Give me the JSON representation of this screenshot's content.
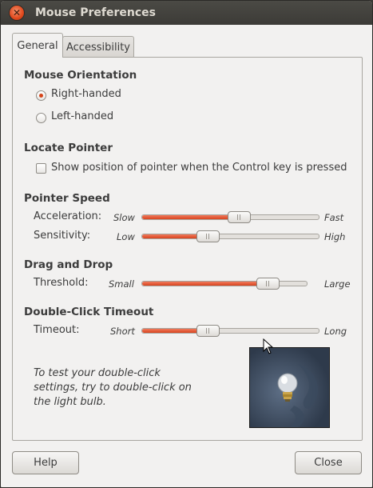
{
  "window": {
    "title": "Mouse Preferences"
  },
  "tabs": [
    {
      "label": "General",
      "active": true
    },
    {
      "label": "Accessibility",
      "active": false
    }
  ],
  "orientation": {
    "heading": "Mouse Orientation",
    "options": [
      {
        "label": "Right-handed",
        "checked": true
      },
      {
        "label": "Left-handed",
        "checked": false
      }
    ]
  },
  "locate": {
    "heading": "Locate Pointer",
    "checkbox_label": "Show position of pointer when the Control key is pressed",
    "checked": false
  },
  "speed": {
    "heading": "Pointer Speed",
    "acceleration": {
      "label": "Acceleration:",
      "min": "Slow",
      "max": "Fast",
      "value": 0.55
    },
    "sensitivity": {
      "label": "Sensitivity:",
      "min": "Low",
      "max": "High",
      "value": 0.35
    }
  },
  "drag": {
    "heading": "Drag and Drop",
    "threshold": {
      "label": "Threshold:",
      "min": "Small",
      "max": "Large",
      "value": 0.8
    }
  },
  "doubleclick": {
    "heading": "Double-Click Timeout",
    "timeout": {
      "label": "Timeout:",
      "min": "Short",
      "max": "Long",
      "value": 0.35
    },
    "test_text": "To test your double-click settings, try to double-click on the light bulb."
  },
  "buttons": {
    "help": "Help",
    "close": "Close"
  },
  "colors": {
    "accent": "#d9441f",
    "titlebar": "#3c3b37"
  },
  "icons": {
    "close": "close-icon",
    "bulb": "light-bulb-icon",
    "cursor": "mouse-pointer-icon"
  }
}
